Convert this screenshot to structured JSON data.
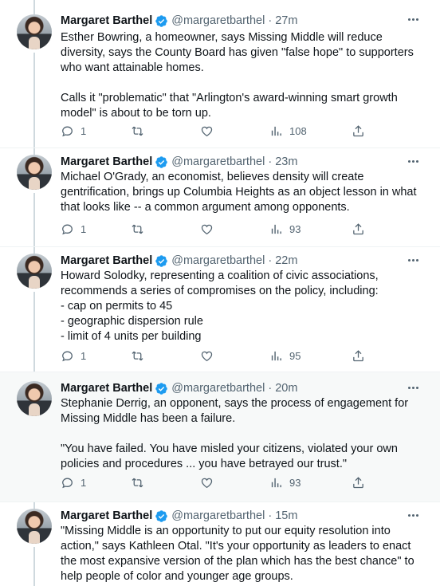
{
  "tweets": [
    {
      "name": "Margaret Barthel",
      "handle": "@margaretbarthel",
      "time": "27m",
      "text": "Esther Bowring, a homeowner, says Missing Middle will reduce diversity, says the County Board has given \"false hope\" to supporters who want attainable homes.\n\nCalls it \"problematic\" that \"Arlington's award-winning smart growth model\" is about to be torn up.",
      "replies": "1",
      "retweets": "",
      "likes": "",
      "views": "108"
    },
    {
      "name": "Margaret Barthel",
      "handle": "@margaretbarthel",
      "time": "23m",
      "text": "Michael O'Grady, an economist, believes density will create gentrification, brings up Columbia Heights as an object lesson in what that looks like -- a common argument among opponents.",
      "replies": "1",
      "retweets": "",
      "likes": "",
      "views": "93"
    },
    {
      "name": "Margaret Barthel",
      "handle": "@margaretbarthel",
      "time": "22m",
      "text": "Howard Solodky, representing a coalition of civic associations, recommends a series of compromises on the policy, including:\n- cap on permits to 45\n- geographic dispersion rule\n- limit of 4 units per building",
      "replies": "1",
      "retweets": "",
      "likes": "",
      "views": "95"
    },
    {
      "name": "Margaret Barthel",
      "handle": "@margaretbarthel",
      "time": "20m",
      "text": "Stephanie Derrig, an opponent, says the process of engagement for Missing Middle has been a failure.\n\n\"You have failed. You have misled your citizens, violated your own policies and procedures ... you have betrayed our trust.\"",
      "replies": "1",
      "retweets": "",
      "likes": "",
      "views": "93"
    },
    {
      "name": "Margaret Barthel",
      "handle": "@margaretbarthel",
      "time": "15m",
      "text": "\"Missing Middle is an opportunity to put our equity resolution into action,\" says Kathleen Otal. \"It's your opportunity as leaders to enact the most expansive version of the plan which has the best chance\" to help people of color and younger age groups.",
      "replies": "",
      "retweets": "",
      "likes": "",
      "views": ""
    }
  ],
  "colors": {
    "accent": "#1d9bf0",
    "secondary_text": "#536471",
    "thread_line": "#cfd9de",
    "highlight_bg": "#f7f9f9"
  },
  "icons": [
    "verified-badge-icon",
    "more-icon",
    "reply-icon",
    "retweet-icon",
    "like-icon",
    "views-icon",
    "share-icon"
  ]
}
